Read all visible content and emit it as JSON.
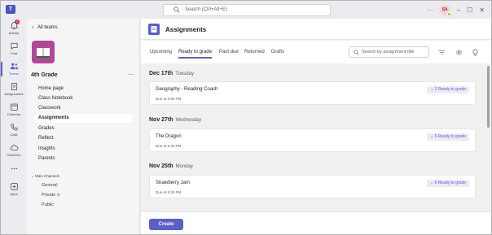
{
  "app": {
    "search_placeholder": "Search (Ctrl+Alt+E)",
    "avatar_initials": "SA",
    "logo_letter": "T"
  },
  "rail": {
    "items": [
      {
        "label": "Activity",
        "icon": "bell-icon",
        "badge": "2"
      },
      {
        "label": "Chat",
        "icon": "chat-icon"
      },
      {
        "label": "Teams",
        "icon": "teams-icon",
        "active": true
      },
      {
        "label": "Assignments",
        "icon": "assignments-icon"
      },
      {
        "label": "Calendar",
        "icon": "calendar-icon"
      },
      {
        "label": "Calls",
        "icon": "phone-icon"
      },
      {
        "label": "OneDrive",
        "icon": "cloud-icon"
      },
      {
        "label": "",
        "icon": "more-icon"
      },
      {
        "label": "Apps",
        "icon": "add-apps-icon"
      }
    ]
  },
  "panel": {
    "back_label": "All teams",
    "team_name": "4th Grade",
    "more_label": "···",
    "nav": [
      "Home page",
      "Class Notebook",
      "Classwork",
      "Assignments",
      "Grades",
      "Reflect",
      "Insights",
      "Parents"
    ],
    "active_nav": "Assignments",
    "channels_header": "Main Channels",
    "channels": [
      "General",
      "Private",
      "Public"
    ]
  },
  "main": {
    "title": "Assignments",
    "tabs": [
      "Upcoming",
      "Ready to grade",
      "Past due",
      "Returned",
      "Drafts"
    ],
    "active_tab": "Ready to grade",
    "search_placeholder": "Search by assignment title",
    "groups": [
      {
        "date": "Dec 17th",
        "weekday": "Tuesday",
        "title": "Geography - Reading Coach",
        "due": "Due at 9:30 PM",
        "badge": "2 Ready to grade"
      },
      {
        "date": "Nov 27th",
        "weekday": "Wednesday",
        "title": "The Dragon",
        "due": "Due at 9:30 PM",
        "badge": "6 Ready to grade"
      },
      {
        "date": "Nov 25th",
        "weekday": "Monday",
        "title": "Strawberry Jam",
        "due": "Due at 9:30 PM",
        "badge": "6 Ready to grade"
      }
    ],
    "create_label": "Create"
  },
  "colors": {
    "accent": "#5b5fc7",
    "team_tile": "#b14895",
    "badge_red": "#c4314b"
  }
}
